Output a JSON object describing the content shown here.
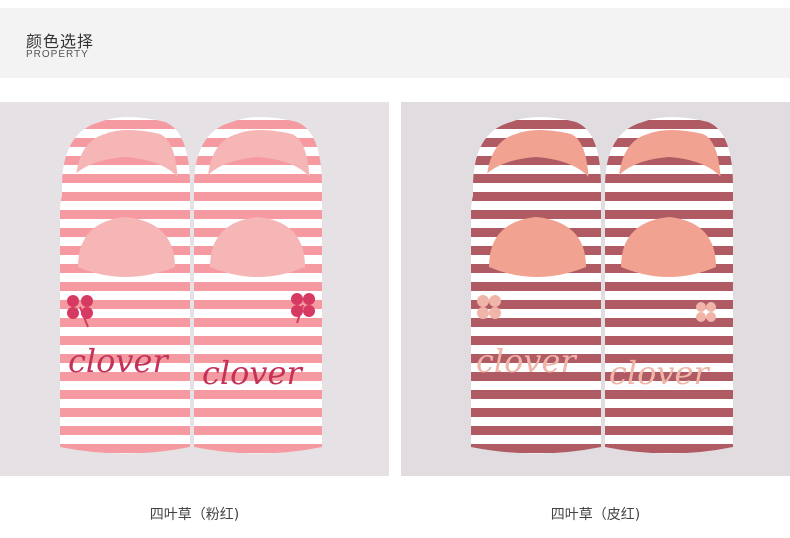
{
  "header": {
    "title": "颜色选择",
    "subtitle": "PROPERTY"
  },
  "products": [
    {
      "caption": "四叶草（粉红)",
      "embroidery_text": "clover",
      "colors": {
        "stripe": "#f49aa0",
        "plush": "#f7b6b6",
        "text": "#c4325a"
      }
    },
    {
      "caption": "四叶草（皮红)",
      "embroidery_text": "clover",
      "colors": {
        "stripe": "#b05a63",
        "plush": "#f1a291",
        "text": "#f0b4a8"
      }
    }
  ]
}
